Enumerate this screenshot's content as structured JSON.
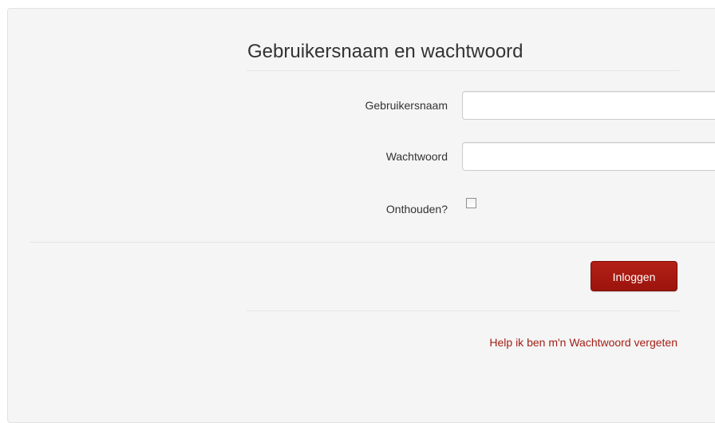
{
  "form": {
    "legend": "Gebruikersnaam en wachtwoord",
    "username": {
      "label": "Gebruikersnaam",
      "value": "",
      "placeholder": ""
    },
    "password": {
      "label": "Wachtwoord",
      "value": "",
      "placeholder": ""
    },
    "remember": {
      "label": "Onthouden?",
      "checked": false
    },
    "submit_label": "Inloggen",
    "forgot_link": "Help ik ben m'n Wachtwoord vergeten"
  },
  "colors": {
    "panel_background": "#f5f5f5",
    "button_background": "#a31a12",
    "link_color": "#a31f16"
  }
}
